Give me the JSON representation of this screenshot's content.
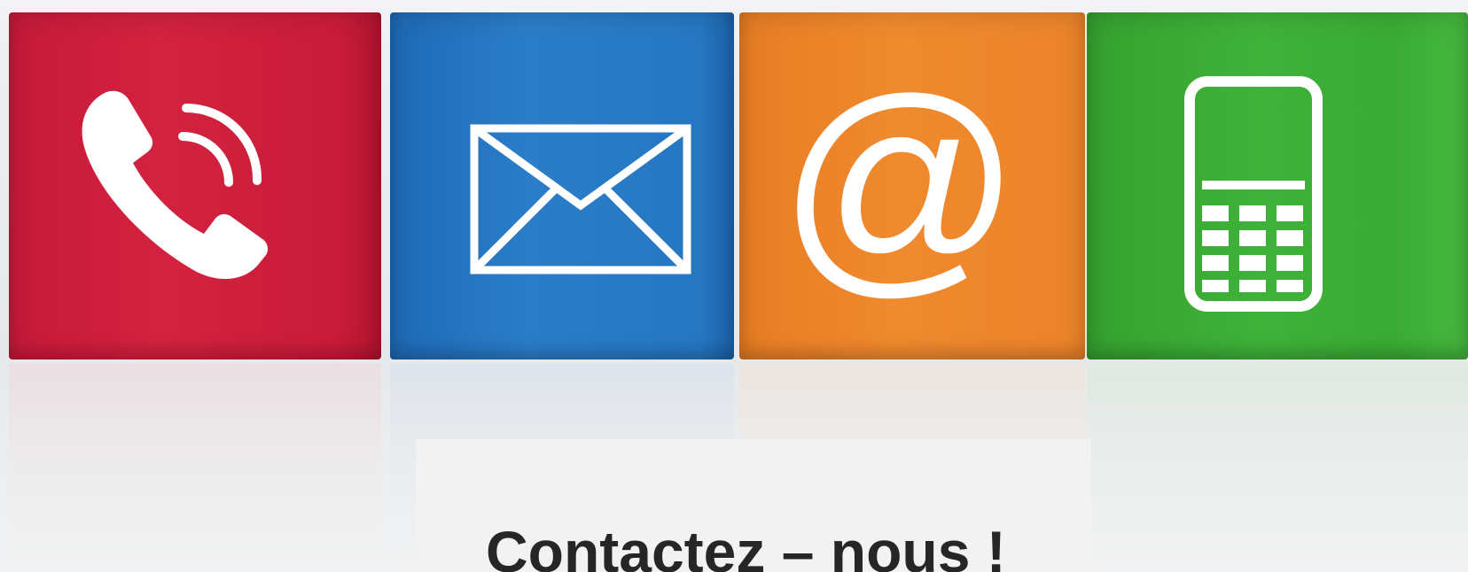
{
  "banner": {
    "cubes": [
      {
        "icon": "phone-icon",
        "color": "#d2223f"
      },
      {
        "icon": "envelope-icon",
        "color": "#2b7dc8"
      },
      {
        "icon": "at-sign-icon",
        "color": "#f08a2e"
      },
      {
        "icon": "mobile-phone-icon",
        "color": "#3fb23a"
      }
    ],
    "at_glyph": "@"
  },
  "contact": {
    "heading": "Contactez – nous !"
  }
}
